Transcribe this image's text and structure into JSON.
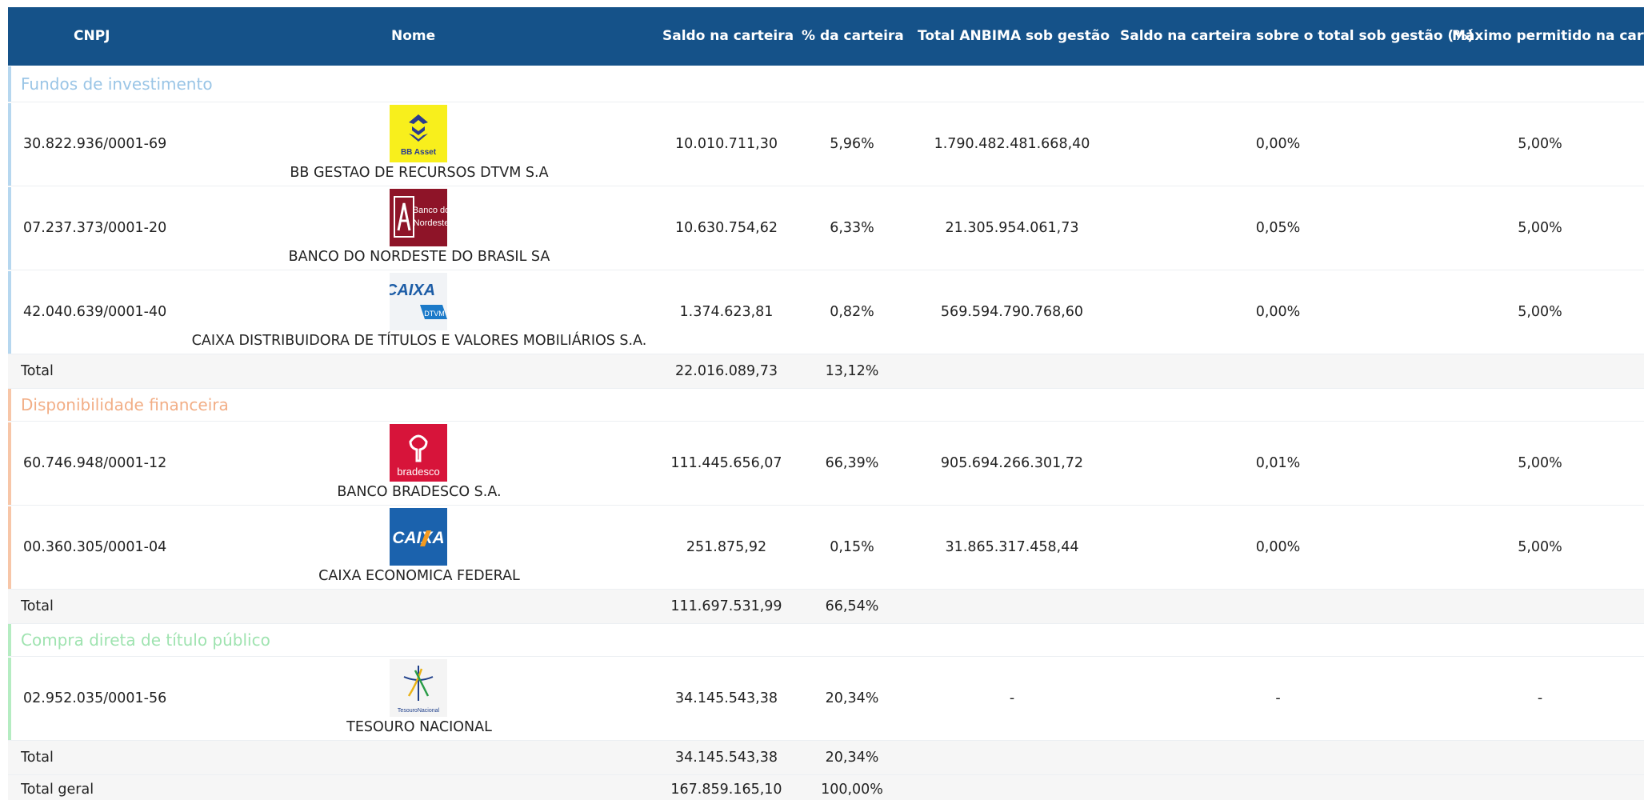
{
  "headers": {
    "cnpj": "CNPJ",
    "nome": "Nome",
    "saldo": "Saldo na carteira",
    "pct": "% da carteira",
    "anbima": "Total ANBIMA sob gestão",
    "saldo_sobre": "Saldo na carteira sobre o total sob gestão (%)",
    "maximo": "Máximo permitido na carteira"
  },
  "groups": [
    {
      "label": "Fundos de investimento",
      "color": "#9ac5e6",
      "rows": [
        {
          "cnpj": "30.822.936/0001-69",
          "nome": "BB GESTAO DE RECURSOS DTVM S.A",
          "logo": "bb-asset-logo",
          "logo_text": "BB Asset",
          "saldo": "10.010.711,30",
          "pct": "5,96%",
          "anbima": "1.790.482.481.668,40",
          "saldo_sobre": "0,00%",
          "maximo": "5,00%"
        },
        {
          "cnpj": "07.237.373/0001-20",
          "nome": "BANCO DO NORDESTE DO BRASIL SA",
          "logo": "banco-do-nordeste-logo",
          "logo_text": "Banco do Nordeste",
          "saldo": "10.630.754,62",
          "pct": "6,33%",
          "anbima": "21.305.954.061,73",
          "saldo_sobre": "0,05%",
          "maximo": "5,00%"
        },
        {
          "cnpj": "42.040.639/0001-40",
          "nome": "CAIXA DISTRIBUIDORA DE TÍTULOS E VALORES MOBILIÁRIOS S.A.",
          "logo": "caixa-dtvm-logo",
          "logo_text": "CAIXA",
          "logo_sub": "DTVM",
          "saldo": "1.374.623,81",
          "pct": "0,82%",
          "anbima": "569.594.790.768,60",
          "saldo_sobre": "0,00%",
          "maximo": "5,00%"
        }
      ],
      "total": {
        "label": "Total",
        "saldo": "22.016.089,73",
        "pct": "13,12%"
      }
    },
    {
      "label": "Disponibilidade financeira",
      "color": "#f2ae86",
      "rows": [
        {
          "cnpj": "60.746.948/0001-12",
          "nome": "BANCO BRADESCO S.A.",
          "logo": "bradesco-logo",
          "logo_text": "bradesco",
          "saldo": "111.445.656,07",
          "pct": "66,39%",
          "anbima": "905.694.266.301,72",
          "saldo_sobre": "0,01%",
          "maximo": "5,00%"
        },
        {
          "cnpj": "00.360.305/0001-04",
          "nome": "CAIXA ECONOMICA FEDERAL",
          "logo": "caixa-logo",
          "logo_text": "CAIXA",
          "saldo": "251.875,92",
          "pct": "0,15%",
          "anbima": "31.865.317.458,44",
          "saldo_sobre": "0,00%",
          "maximo": "5,00%"
        }
      ],
      "total": {
        "label": "Total",
        "saldo": "111.697.531,99",
        "pct": "66,54%"
      }
    },
    {
      "label": "Compra direta de título público",
      "color": "#9fe3b0",
      "rows": [
        {
          "cnpj": "02.952.035/0001-56",
          "nome": "TESOURO NACIONAL",
          "logo": "tesouro-nacional-logo",
          "logo_text": "TesouroNacional",
          "saldo": "34.145.543,38",
          "pct": "20,34%",
          "anbima": "-",
          "saldo_sobre": "-",
          "maximo": "-"
        }
      ],
      "total": {
        "label": "Total",
        "saldo": "34.145.543,38",
        "pct": "20,34%"
      }
    }
  ],
  "grand_total": {
    "label": "Total geral",
    "saldo": "167.859.165,10",
    "pct": "100,00%"
  }
}
